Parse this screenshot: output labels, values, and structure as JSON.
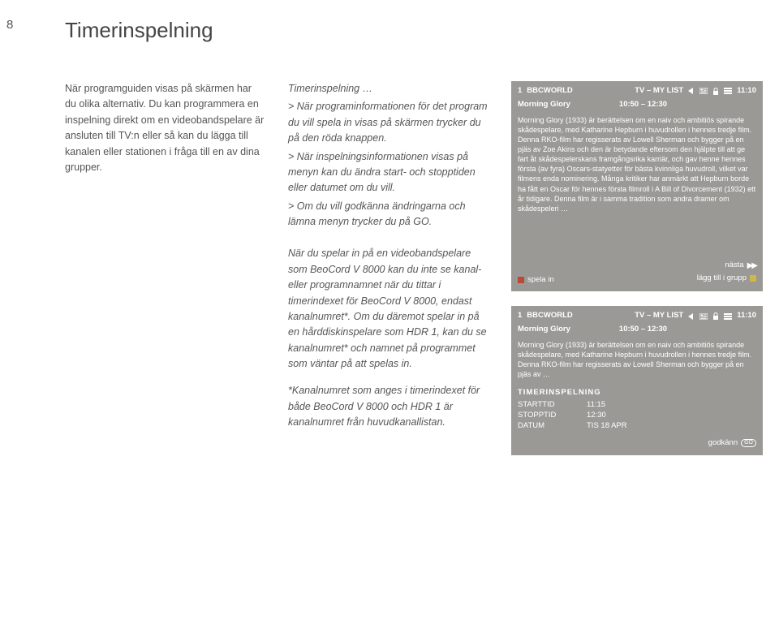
{
  "page_number": "8",
  "title": "Timerinspelning",
  "col1": {
    "p1": "När programguiden visas på skärmen har du olika alternativ. Du kan programmera en inspelning direkt om en videobandspelare är ansluten till TV:n eller så kan du lägga till kanalen eller stationen i fråga till en av dina grupper."
  },
  "col2": {
    "section_label": "Timerinspelning …",
    "instr1": "> När programinformationen för det program du vill spela in visas på skärmen trycker du på den röda knappen.",
    "instr2": "> När inspelningsinformationen visas på menyn kan du ändra start- och stopptiden eller datumet om du vill.",
    "instr3": "> Om du vill godkänna ändringarna och lämna menyn trycker du på GO.",
    "note": "När du spelar in på en videobandspelare som BeoCord V 8000 kan du inte se kanal- eller programnamnet när du tittar i timerindexet för BeoCord V 8000, endast kanalnumret*. Om du däremot spelar in på en hårddiskinspelare som HDR 1, kan du se kanalnumret* och namnet på programmet som väntar på att spelas in.",
    "footnote": "*Kanalnumret som anges i timerindexet för både BeoCord V 8000 och HDR 1 är kanalnumret från huvudkanallistan."
  },
  "panel1": {
    "ch": "1",
    "channel": "BBCWORLD",
    "label": "TV – MY LIST",
    "clock": "11:10",
    "program": "Morning  Glory",
    "time": "10:50 – 12:30",
    "desc": "Morning Glory (1933) är berättelsen om en naiv och ambitiös spirande skådespelare, med Katharine Hepburn i huvudrollen i hennes tredje film. Denna RKO-film har regisserats av Lowell Sherman och bygger på en pjäs av Zoe Akins och den är betydande eftersom den hjälpte till att ge fart åt skådespelerskans framgångsrika karriär, och gav henne hennes första (av fyra) Oscars-statyetter för bästa kvinnliga huvudroll, vilket var filmens enda nominering. Många kritiker har anmärkt att Hepburn borde ha fått en Oscar för hennes första filmroll i A Bill of Divorcement (1932) ett år tidigare. Denna film är i samma tradition som andra dramer om skådespeleri …",
    "action_record": "spela in",
    "action_next": "nästa",
    "action_group": "lägg till i grupp"
  },
  "panel2": {
    "ch": "1",
    "channel": "BBCWORLD",
    "label": "TV – MY LIST",
    "clock": "11:10",
    "program": "Morning  Glory",
    "time": "10:50 – 12:30",
    "desc": "Morning Glory (1933) är berättelsen om en naiv och ambitiös spirande skådespelare, med Katharine Hepburn i huvudrollen i hennes tredje film. Denna RKO-film har regisserats av Lowell Sherman och bygger på en pjäs av …",
    "timer_title": "TIMERINSPELNING",
    "rows": [
      {
        "k": "STARTTID",
        "v": "11:15"
      },
      {
        "k": "STOPPTID",
        "v": "12:30"
      },
      {
        "k": "DATUM",
        "v": "TIS 18 APR"
      }
    ],
    "approve": "godkänn",
    "go": "GO"
  }
}
